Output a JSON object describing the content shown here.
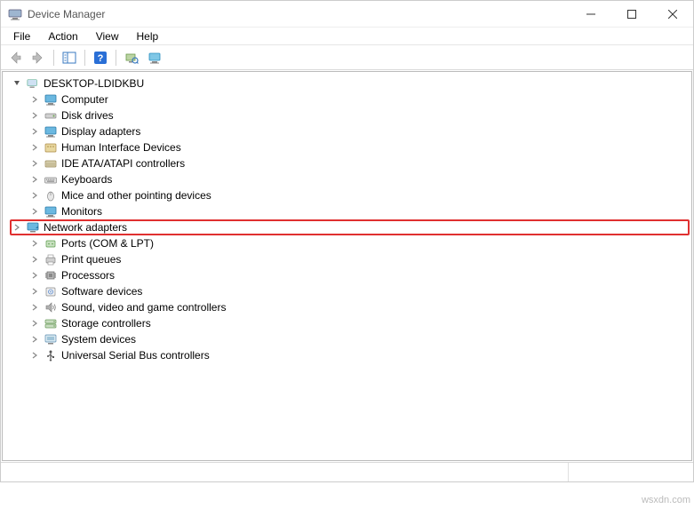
{
  "window": {
    "title": "Device Manager"
  },
  "menubar": {
    "items": [
      "File",
      "Action",
      "View",
      "Help"
    ]
  },
  "tree": {
    "root": {
      "label": "DESKTOP-LDIDKBU",
      "expanded": true
    },
    "categories": [
      {
        "label": "Computer",
        "icon": "monitor",
        "highlighted": false
      },
      {
        "label": "Disk drives",
        "icon": "disk",
        "highlighted": false
      },
      {
        "label": "Display adapters",
        "icon": "monitor",
        "highlighted": false
      },
      {
        "label": "Human Interface Devices",
        "icon": "hid",
        "highlighted": false
      },
      {
        "label": "IDE ATA/ATAPI controllers",
        "icon": "ide",
        "highlighted": false
      },
      {
        "label": "Keyboards",
        "icon": "keyboard",
        "highlighted": false
      },
      {
        "label": "Mice and other pointing devices",
        "icon": "mouse",
        "highlighted": false
      },
      {
        "label": "Monitors",
        "icon": "monitor",
        "highlighted": false
      },
      {
        "label": "Network adapters",
        "icon": "network",
        "highlighted": true
      },
      {
        "label": "Ports (COM & LPT)",
        "icon": "port",
        "highlighted": false
      },
      {
        "label": "Print queues",
        "icon": "printer",
        "highlighted": false
      },
      {
        "label": "Processors",
        "icon": "cpu",
        "highlighted": false
      },
      {
        "label": "Software devices",
        "icon": "software",
        "highlighted": false
      },
      {
        "label": "Sound, video and game controllers",
        "icon": "sound",
        "highlighted": false
      },
      {
        "label": "Storage controllers",
        "icon": "storage",
        "highlighted": false
      },
      {
        "label": "System devices",
        "icon": "system",
        "highlighted": false
      },
      {
        "label": "Universal Serial Bus controllers",
        "icon": "usb",
        "highlighted": false
      }
    ]
  },
  "watermark": "wsxdn.com"
}
